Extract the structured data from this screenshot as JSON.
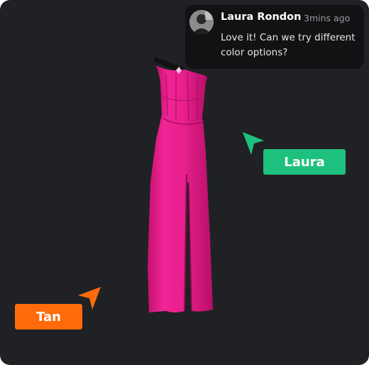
{
  "comment": {
    "author": "Laura Rondon",
    "time": "3mins ago",
    "text": "Love it! Can we try different color options?",
    "avatar_icon": "user-avatar"
  },
  "cursors": [
    {
      "name": "Laura",
      "color": "#1ec07d",
      "icon": "cursor-arrow-icon"
    },
    {
      "name": "Tan",
      "color": "#ff6b0a",
      "icon": "cursor-arrow-icon"
    }
  ],
  "product": {
    "icon": "strapless-dress-image",
    "color": "#e8208e"
  },
  "colors": {
    "background": "#202124",
    "comment_bg": "#121214"
  }
}
